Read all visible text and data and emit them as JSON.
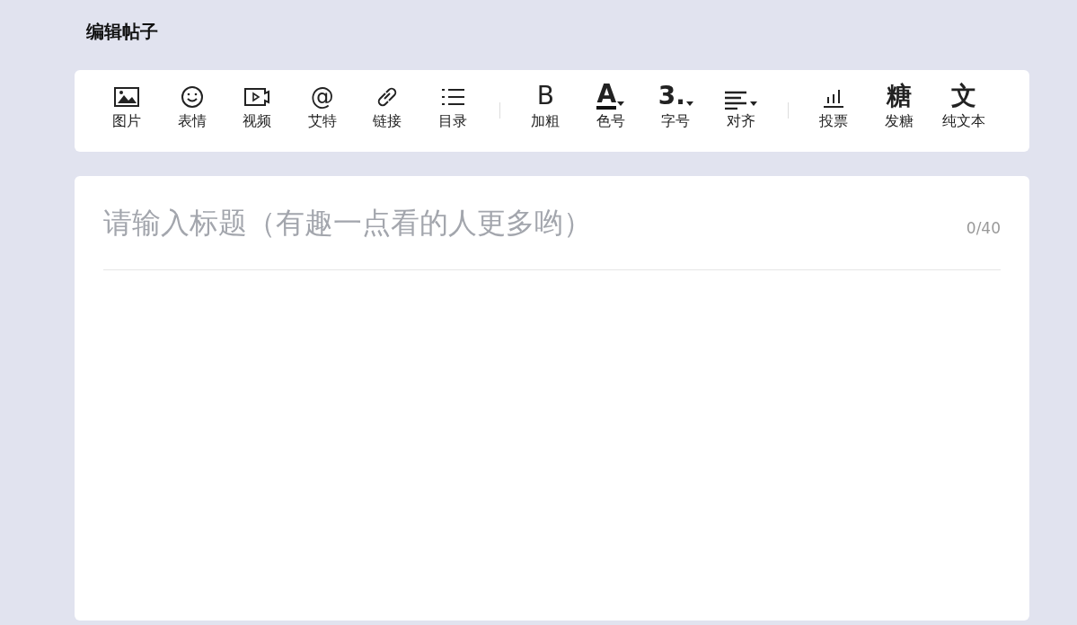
{
  "page_title": "编辑帖子",
  "toolbar": {
    "groups": [
      {
        "tools": [
          {
            "label": "图片"
          },
          {
            "label": "表情"
          },
          {
            "label": "视频"
          },
          {
            "label": "艾特",
            "glyph": "@",
            "dropdown": false
          },
          {
            "label": "链接"
          },
          {
            "label": "目录"
          }
        ]
      },
      {
        "tools": [
          {
            "label": "加粗",
            "glyph": "B",
            "dropdown": false
          },
          {
            "label": "色号",
            "glyph": "A",
            "dropdown": true
          },
          {
            "label": "字号",
            "glyph": "3.",
            "dropdown": true
          },
          {
            "label": "对齐",
            "dropdown": true
          }
        ]
      },
      {
        "tools": [
          {
            "label": "投票"
          },
          {
            "label": "发糖",
            "glyph": "糖",
            "dropdown": false
          },
          {
            "label": "纯文本",
            "glyph": "文",
            "dropdown": false
          }
        ]
      }
    ]
  },
  "editor": {
    "title_placeholder": "请输入标题（有趣一点看的人更多哟）",
    "counter": "0/40"
  }
}
